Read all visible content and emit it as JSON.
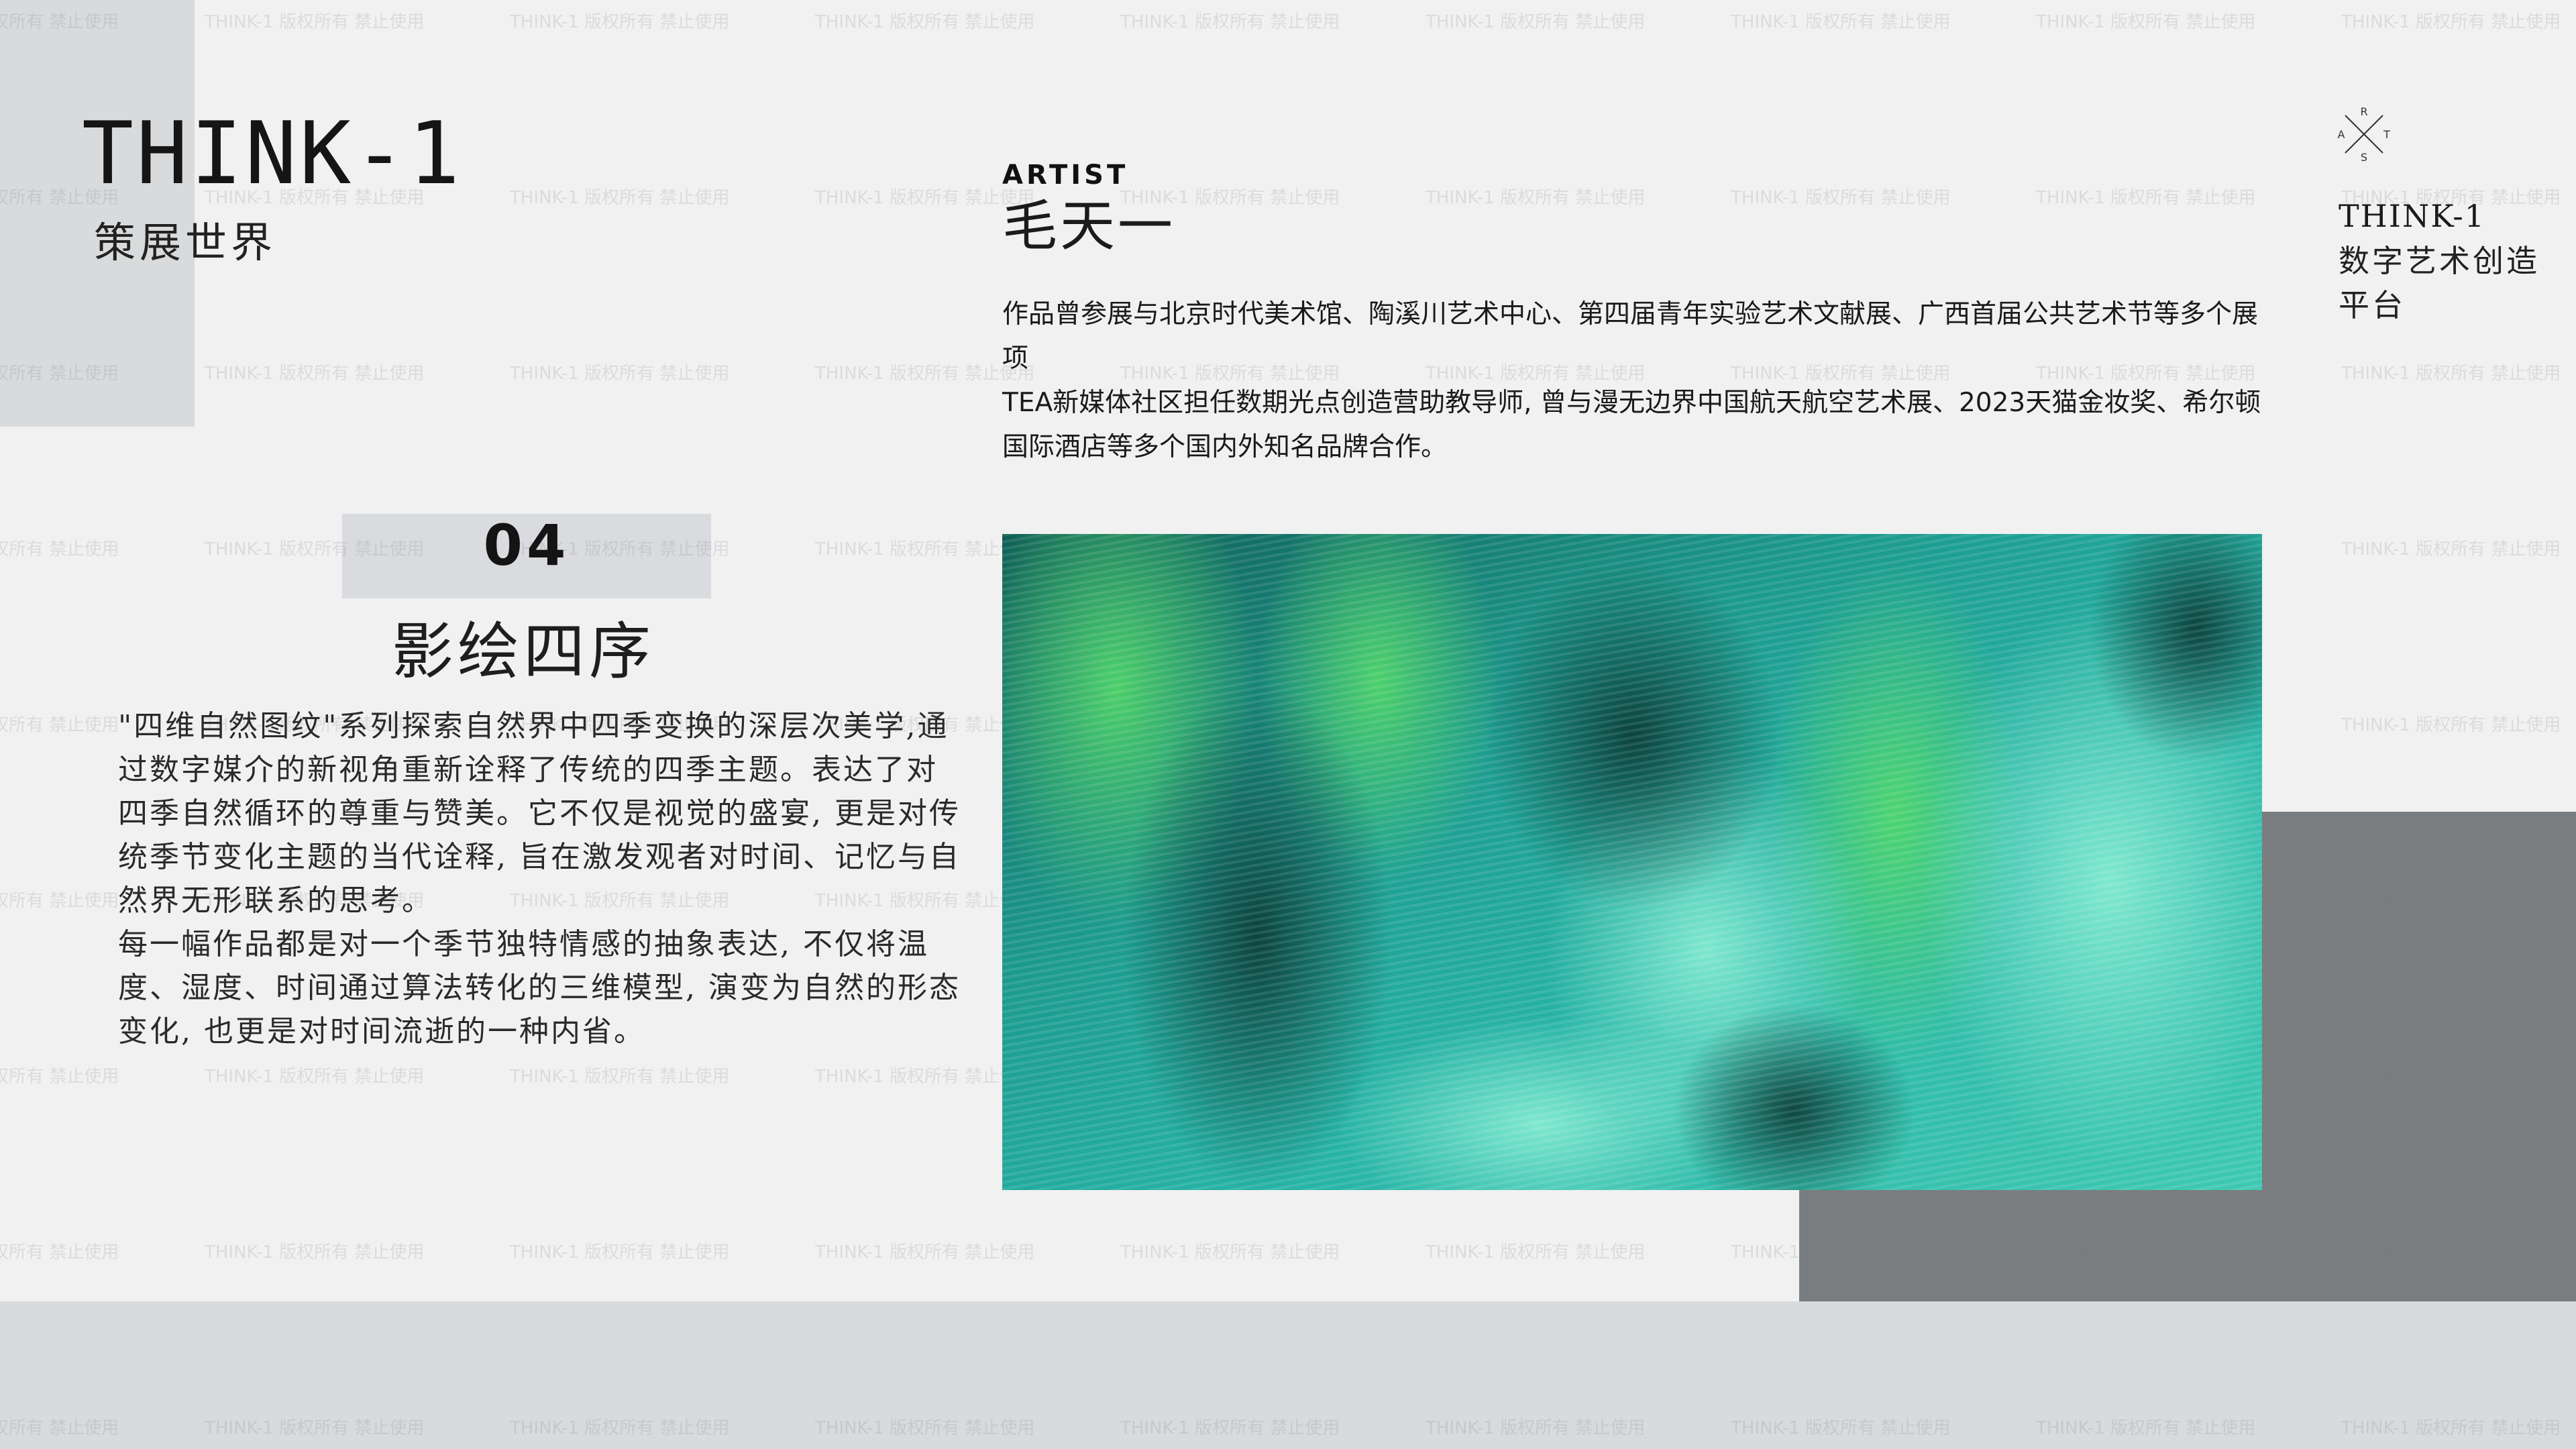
{
  "brand": {
    "title": "THINK-1",
    "subtitle": "策展世界"
  },
  "work": {
    "number": "04",
    "title": "影绘四序",
    "description": [
      "\"四维自然图纹\"系列探索自然界中四季变换的深层次美学,通过数字媒介的新视角重新诠释了传统的四季主题。表达了对四季自然循环的尊重与赞美。它不仅是视觉的盛宴, 更是对传统季节变化主题的当代诠释, 旨在激发观者对时间、记忆与自然界无形联系的思考。",
      "每一幅作品都是对一个季节独特情感的抽象表达, 不仅将温度、湿度、时间通过算法转化的三维模型, 演变为自然的形态变化, 也更是对时间流逝的一种内省。"
    ]
  },
  "artist": {
    "label": "ARTIST",
    "name": "毛天一",
    "bio": [
      "作品曾参展与北京时代美术馆、陶溪川艺术中心、第四届青年实验艺术文献展、广西首届公共艺术节等多个展项",
      "TEA新媒体社区担任数期光点创造营助教导师, 曾与漫无边界中国航天航空艺术展、2023天猫金妆奖、希尔顿国际酒店等多个国内外知名品牌合作。"
    ]
  },
  "platform": {
    "logo_letters": {
      "top": "R",
      "left": "A",
      "right": "T",
      "bottom": "S"
    },
    "name": "THINK-1",
    "description": "数字艺术创造平台"
  },
  "watermark": "THINK-1 版权所有 禁止使用",
  "colors": {
    "background": "#f1f1f1",
    "light_gray_block": "#d8dadc",
    "dark_gray_block": "#7a7d80",
    "artwork_teal": "#1fa39a",
    "artwork_green": "#3ac46a"
  }
}
